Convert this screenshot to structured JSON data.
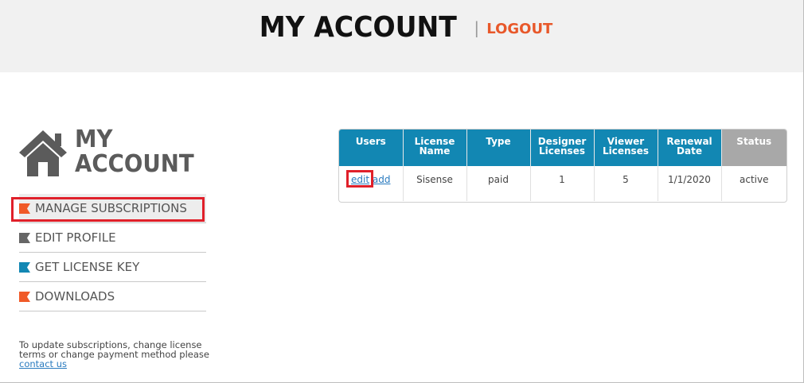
{
  "header": {
    "title": "MY ACCOUNT",
    "separator": "|",
    "logout": "LOGOUT"
  },
  "brand": {
    "line1": "MY",
    "line2": "ACCOUNT"
  },
  "nav": {
    "items": [
      {
        "label": "MANAGE SUBSCRIPTIONS",
        "color": "#f05a28"
      },
      {
        "label": "EDIT PROFILE",
        "color": "#666666"
      },
      {
        "label": "GET LICENSE KEY",
        "color": "#1287b3"
      },
      {
        "label": "DOWNLOADS",
        "color": "#f05a28"
      }
    ]
  },
  "help": {
    "text": "To update subscriptions, change license terms or change payment method please",
    "link": "contact us"
  },
  "table": {
    "headers": [
      "Users",
      "License Name",
      "Type",
      "Designer Licenses",
      "Viewer Licenses",
      "Renewal Date",
      "Status"
    ],
    "row": {
      "edit": "edit",
      "add": "add",
      "license_name": "Sisense",
      "type": "paid",
      "designer": "1",
      "viewer": "5",
      "renewal": "1/1/2020",
      "status": "active"
    }
  },
  "colors": {
    "accent": "#f05a28",
    "table_header": "#1287b3",
    "status_header": "#a8a8a8",
    "highlight": "#e0202a"
  }
}
